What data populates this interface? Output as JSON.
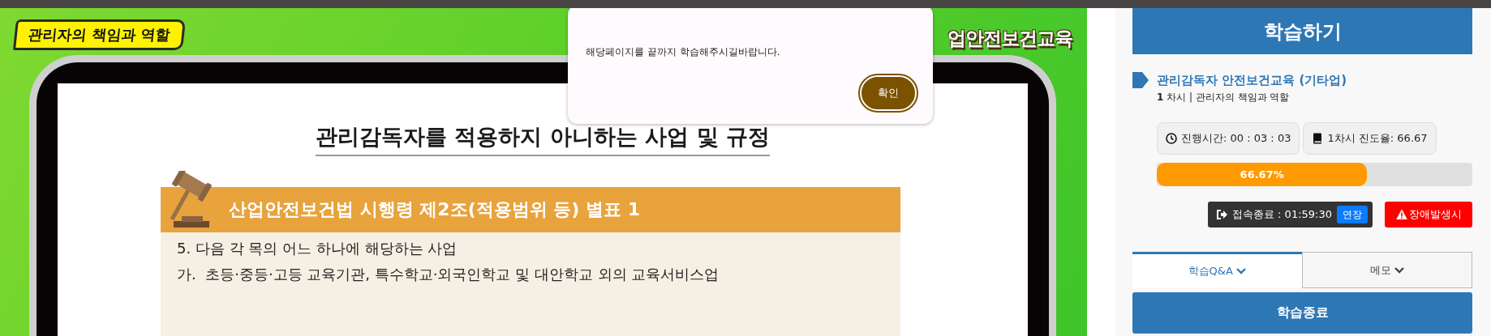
{
  "video": {
    "badge": "관리자의 책임과 역할",
    "course_banner": "업안전보건교육",
    "slide": {
      "title": "관리감독자를 적용하지 아니하는 사업 및 규정",
      "section_header": "산업안전보건법 시행령 제2조(적용범위 등) 별표 1",
      "lines": [
        "5. 다음 각 목의 어느 하나에 해당하는 사업",
        "가.  초등·중등·고등 교육기관, 특수학교·외국인학교 및 대안학교 외의 교육서비스업"
      ]
    }
  },
  "dialog": {
    "message": "해당페이지를 끝까지 학습해주시길바랍니다.",
    "button": "확인"
  },
  "sidebar": {
    "header": "학습하기",
    "course_title": "관리감독자 안전보건교육 (기타업)",
    "lesson": "**1** 차시 | 관리자의 책임과 역할",
    "elapsed": "진행시간: 00 : 03 : 03",
    "lesson_progress": "1차시 진도율: 66.67",
    "progress": {
      "level": 0.6667,
      "label": "66.67%"
    },
    "session": {
      "label": "접속종료 : 01:59:30",
      "extend_button": "연장"
    },
    "error_button": "장애발생시",
    "tabs": [
      {
        "label": "학습Q&A",
        "selected": true
      },
      {
        "label": "메모",
        "selected": false
      }
    ],
    "end_button": "학습종료"
  }
}
